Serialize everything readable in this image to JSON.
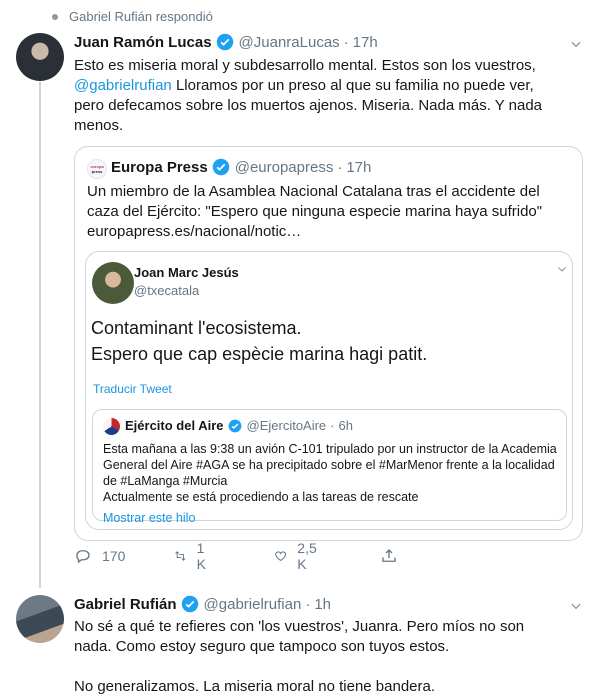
{
  "context": {
    "text": "Gabriel Rufián respondió"
  },
  "tweet1": {
    "name": "Juan Ramón Lucas",
    "handle": "@JuanraLucas",
    "time": "17h",
    "line1": "Esto es miseria moral y subdesarrollo mental. Estos son los vuestros,",
    "mention": "@gabrielrufian",
    "line2_rest": " Lloramos por un preso al que su familia no puede ver,",
    "line3": "pero defecamos sobre los muertos ajenos. Miseria. Nada más. Y nada",
    "line4": "menos."
  },
  "quote": {
    "logo_line1": "europa",
    "logo_line2": "press",
    "name": "Europa Press",
    "handle": "@europapress",
    "time": "17h",
    "line1": "Un miembro de la Asamblea Nacional Catalana tras el accidente del",
    "line2": "caza del Ejército: \"Espero que ninguna especie marina haya sufrido\"",
    "line3": "europapress.es/nacional/notic…"
  },
  "inner": {
    "name": "Joan Marc Jesús",
    "handle": "@txecatala",
    "line1": "Contaminant l'ecosistema.",
    "line2": "Espero que cap espècie marina hagi patit.",
    "translate": "Traducir Tweet"
  },
  "nested": {
    "name": "Ejército del Aire",
    "handle": "@EjercitoAire",
    "time": "6h",
    "line1": "Esta mañana a las 9:38 un avión C-101 tripulado por un instructor de la Academia",
    "line2": "General del Aire #AGA se ha precipitado sobre el #MarMenor frente a la localidad",
    "line3": "de #LaManga #Murcia",
    "line4": "Actualmente se está procediendo a las tareas de rescate",
    "show_thread": "Mostrar este hilo"
  },
  "actions": {
    "reply_count": "170",
    "retweet_count": "1 K",
    "like_count": "2,5 K"
  },
  "tweet2": {
    "name": "Gabriel Rufián",
    "handle": "@gabrielrufian",
    "time": "1h",
    "line1": "No sé a qué te refieres con 'los vuestros', Juanra. Pero míos no son",
    "line2": "nada. Como estoy seguro que tampoco son tuyos estos.",
    "line3": "No generalizamos. La miseria moral no tiene bandera."
  },
  "colors": {
    "accent": "#1b95e0",
    "muted": "#657786",
    "border": "#ccd6dd",
    "verified": "#1da1f2"
  },
  "icons": [
    "retweet-icon",
    "verified-icon",
    "chevron-down-icon",
    "reply-icon",
    "like-icon",
    "share-icon"
  ]
}
